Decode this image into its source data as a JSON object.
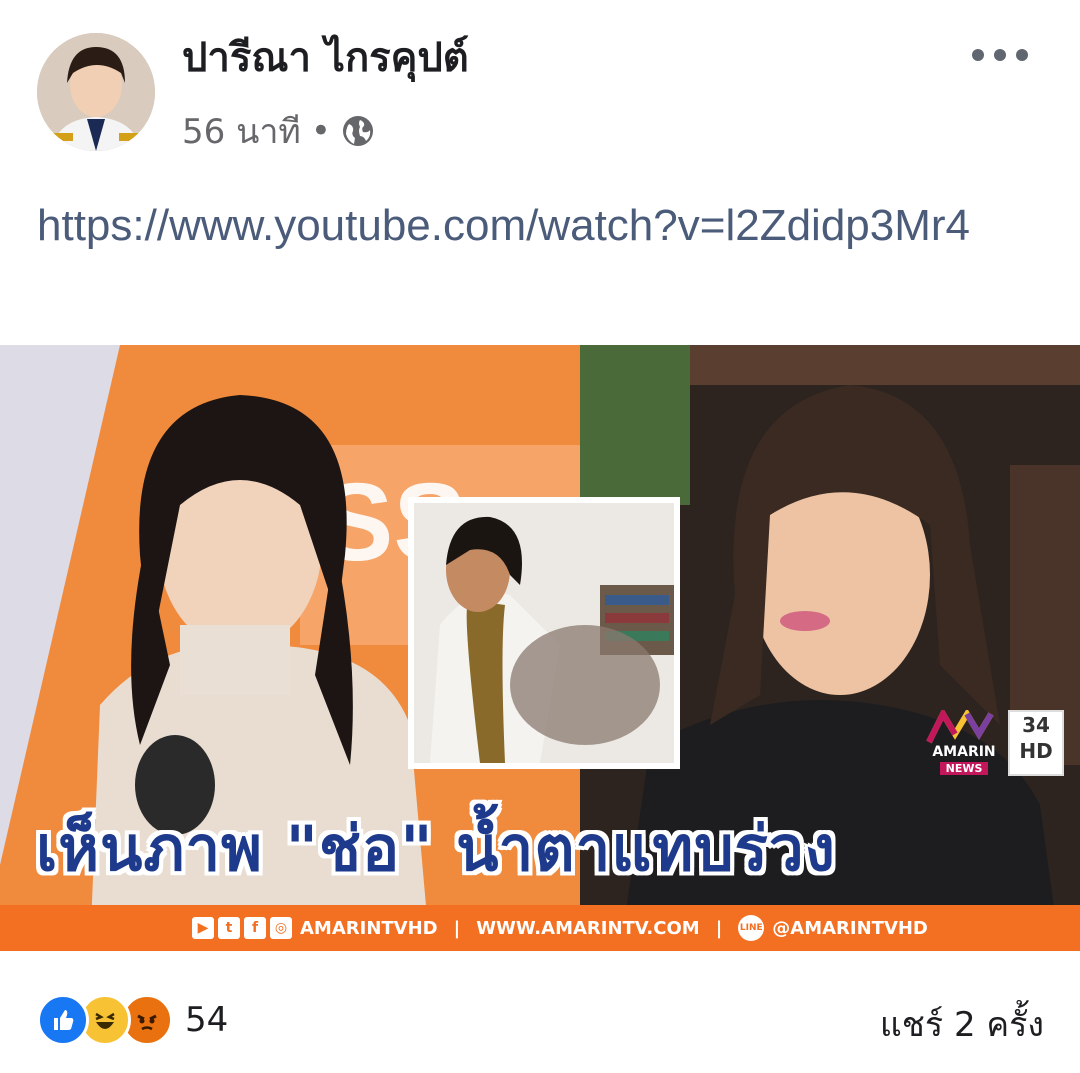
{
  "post": {
    "author": "ปารีณา ไกรคุปต์",
    "time": "56 นาที",
    "separator": "•",
    "privacy_icon": "globe-icon",
    "more_icon": "more-options-icon",
    "link_url": "https://www.youtube.com/watch?v=l2Zdidp3Mr4"
  },
  "thumbnail": {
    "caption": "เห็นภาพ \"ช่อ\" น้ำตาแทบร่วง",
    "channel_logo": "AMARIN",
    "channel_sub": "NEWS",
    "channel_number": "34",
    "channel_hd": "HD",
    "banner": {
      "handle_1": "AMARINTVHD",
      "website": "WWW.AMARINTV.COM",
      "line_handle": "@AMARINTVHD",
      "sep": "|"
    }
  },
  "footer": {
    "reaction_count": "54",
    "reactions": [
      "like-icon",
      "haha-icon",
      "angry-icon"
    ],
    "shares": "แชร์ 2 ครั้ง"
  },
  "colors": {
    "link": "#4b5b7a",
    "banner_orange": "#f36f21",
    "caption_blue": "#1e3a8c",
    "like_blue": "#1877f2"
  }
}
